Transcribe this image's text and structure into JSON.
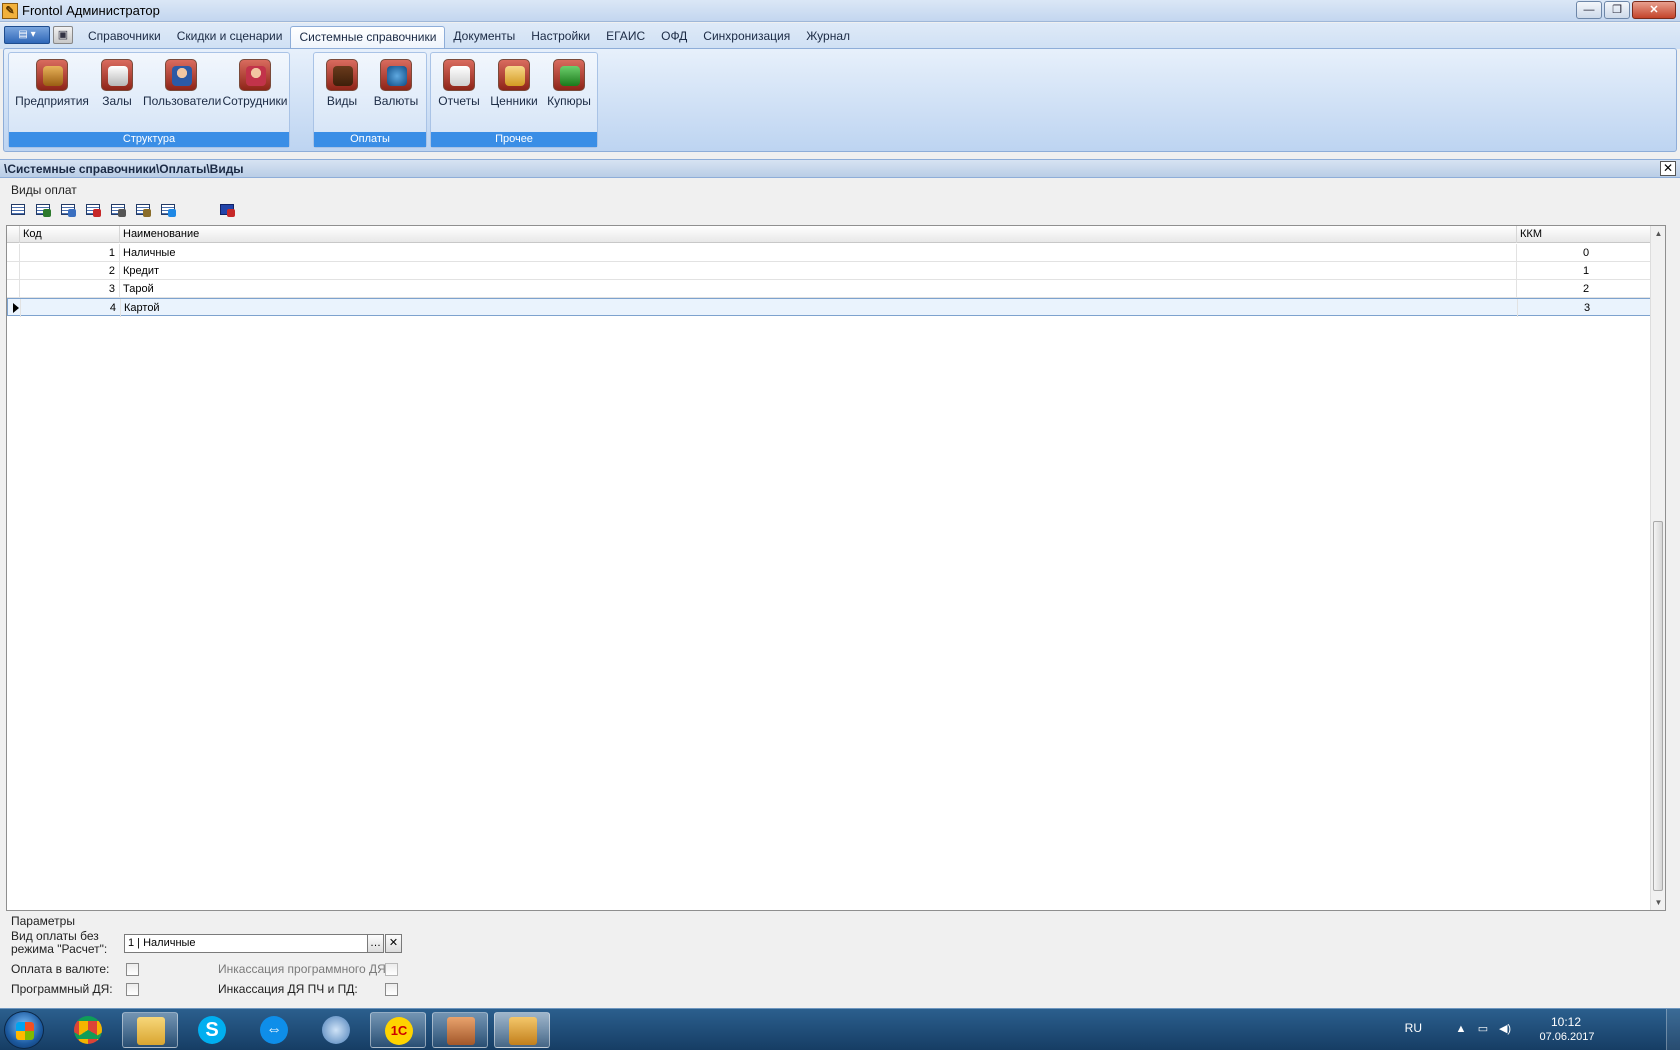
{
  "window": {
    "title": "Frontol Администратор",
    "controls": [
      "—",
      "❐",
      "✕"
    ]
  },
  "ribbon": {
    "tabs": [
      "Справочники",
      "Скидки и сценарии",
      "Системные справочники",
      "Документы",
      "Настройки",
      "ЕГАИС",
      "ОФД",
      "Синхронизация",
      "Журнал"
    ],
    "active_tab": "Системные справочники",
    "groups": [
      {
        "label": "Структура",
        "buttons": [
          {
            "label": "Предприятия",
            "icon": "building-icon"
          },
          {
            "label": "Залы",
            "icon": "hall-icon"
          },
          {
            "label": "Пользователи",
            "icon": "users-icon"
          },
          {
            "label": "Сотрудники",
            "icon": "staff-icon"
          }
        ]
      },
      {
        "label": "Оплаты",
        "buttons": [
          {
            "label": "Виды",
            "icon": "wallet-icon"
          },
          {
            "label": "Валюты",
            "icon": "currency-icon"
          }
        ]
      },
      {
        "label": "Прочее",
        "buttons": [
          {
            "label": "Отчеты",
            "icon": "report-icon"
          },
          {
            "label": "Ценники",
            "icon": "price-tag-icon"
          },
          {
            "label": "Купюры",
            "icon": "banknote-icon"
          }
        ]
      }
    ]
  },
  "breadcrumb": "\\Системные справочники\\Оплаты\\Виды",
  "section": {
    "title": "Виды оплат"
  },
  "grid": {
    "columns": {
      "code": "Код",
      "name": "Наименование",
      "kkm": "ККМ"
    },
    "rows": [
      {
        "code": "1",
        "name": "Наличные",
        "kkm": "0"
      },
      {
        "code": "2",
        "name": "Кредит",
        "kkm": "1"
      },
      {
        "code": "3",
        "name": "Тарой",
        "kkm": "2"
      },
      {
        "code": "4",
        "name": "Картой",
        "kkm": "3"
      }
    ],
    "selected_row": 4
  },
  "params": {
    "title": "Параметры",
    "payment_type_label_1": "Вид оплаты без",
    "payment_type_label_2": "режима \"Расчет\":",
    "payment_type_value": "1 | Наличные",
    "currency_payment_label": "Оплата в валюте:",
    "program_dya_label": "Программный ДЯ:",
    "collection_program_label": "Инкассация программного ДЯ:",
    "collection_dya_label": "Инкассация ДЯ ПЧ и ПД:"
  },
  "taskbar": {
    "language": "RU",
    "time": "10:12",
    "date": "07.06.2017"
  },
  "colors": {
    "ribbon_group_label": "#3a8ee6",
    "selection": "#eaf3fd",
    "taskbar": "#1f4b78"
  }
}
